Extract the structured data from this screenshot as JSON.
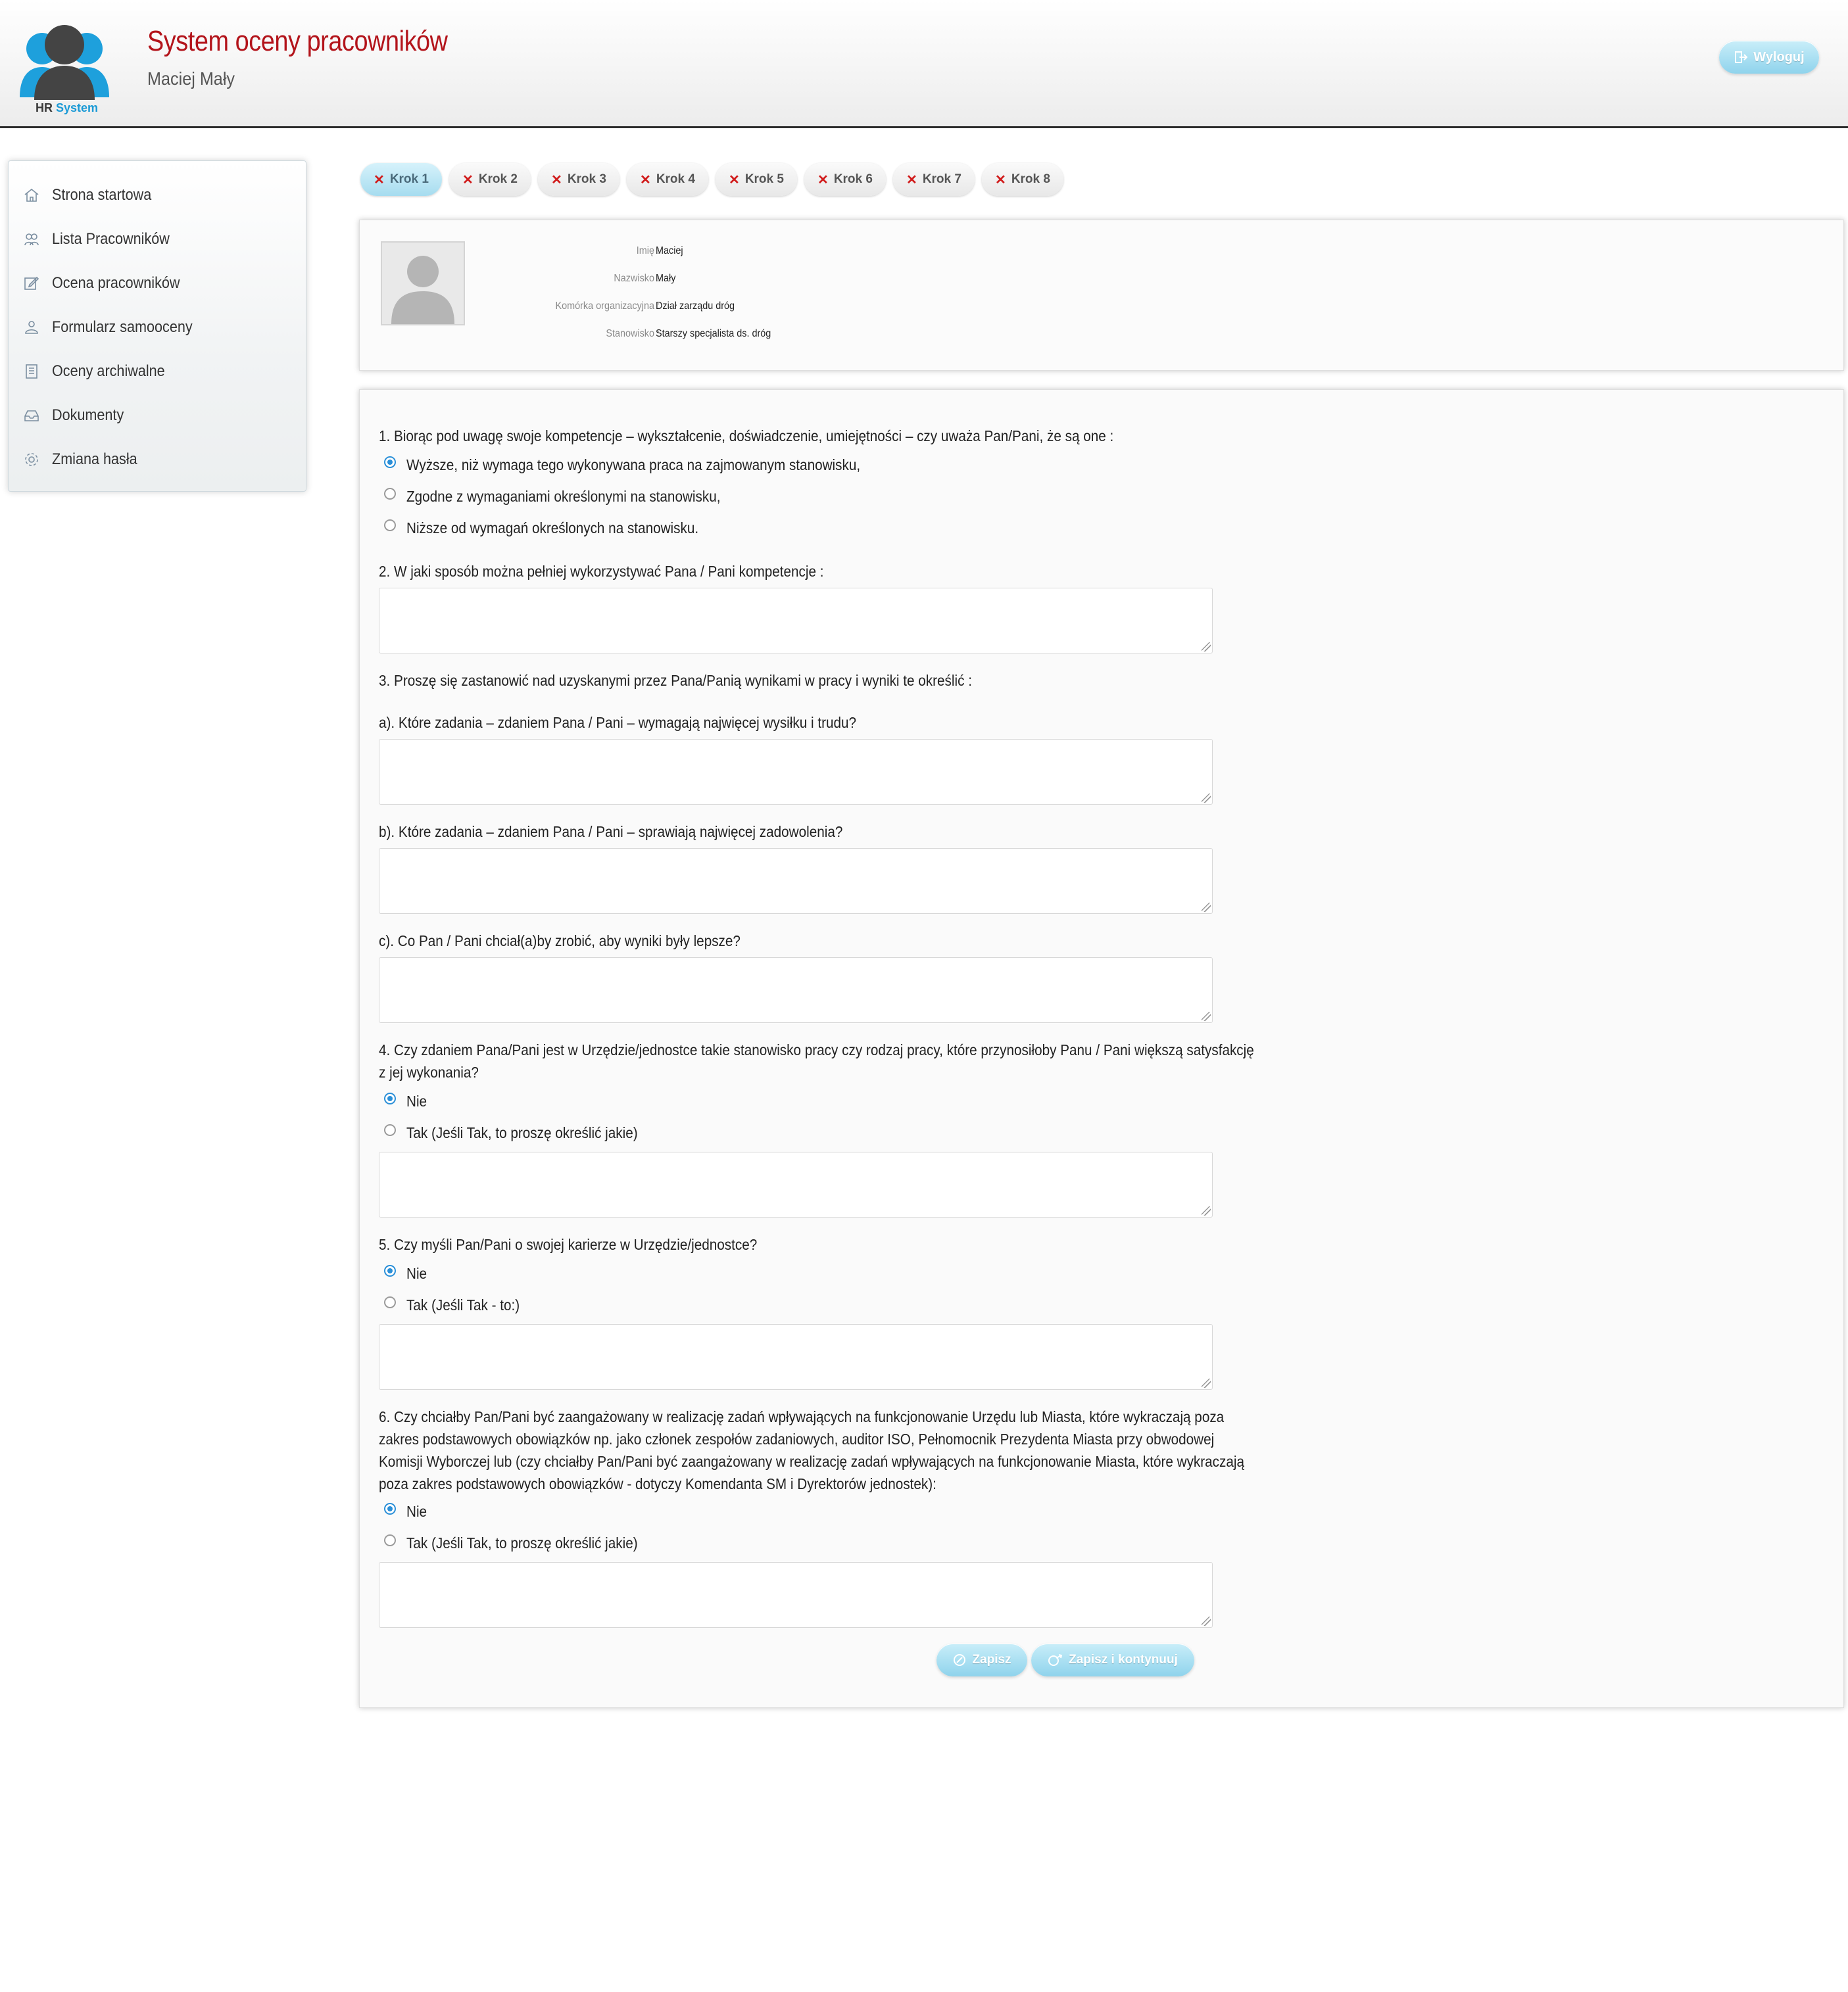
{
  "header": {
    "logo_text_main": "HR",
    "logo_text_accent": "System",
    "title": "System oceny pracowników",
    "user": "Maciej Mały",
    "logout_label": "Wyloguj"
  },
  "sidebar": {
    "items": [
      {
        "label": "Strona startowa",
        "icon": "home-icon"
      },
      {
        "label": "Lista Pracowników",
        "icon": "users-icon"
      },
      {
        "label": "Ocena pracowników",
        "icon": "edit-icon"
      },
      {
        "label": "Formularz samooceny",
        "icon": "person-icon"
      },
      {
        "label": "Oceny archiwalne",
        "icon": "archive-icon"
      },
      {
        "label": "Dokumenty",
        "icon": "inbox-icon"
      },
      {
        "label": "Zmiana hasła",
        "icon": "gear-icon"
      }
    ]
  },
  "tabs": [
    {
      "label": "Krok 1",
      "active": true
    },
    {
      "label": "Krok 2"
    },
    {
      "label": "Krok 3"
    },
    {
      "label": "Krok 4"
    },
    {
      "label": "Krok 5"
    },
    {
      "label": "Krok 6"
    },
    {
      "label": "Krok 7"
    },
    {
      "label": "Krok 8"
    }
  ],
  "employee": {
    "first_name_label": "Imię :",
    "first_name": "Maciej",
    "last_name_label": "Nazwisko :",
    "last_name": "Mały",
    "unit_label": "Komórka organizacyjna :",
    "unit": "Dział zarządu dróg",
    "position_label": "Stanowisko :",
    "position": "Starszy specjalista ds. dróg"
  },
  "form": {
    "q1": "1. Biorąc pod uwagę swoje kompetencje – wykształcenie, doświadczenie, umiejętności – czy uważa Pan/Pani, że są one :",
    "q1_options": [
      "Wyższe, niż wymaga tego wykonywana praca na zajmowanym stanowisku,",
      "Zgodne z wymaganiami określonymi na stanowisku,",
      "Niższe od wymagań określonych na stanowisku."
    ],
    "q1_selected": 0,
    "q2": "2. W jaki sposób można pełniej wykorzystywać Pana / Pani kompetencje :",
    "q3": "3. Proszę się zastanowić nad uzyskanymi przez Pana/Panią wynikami w pracy i wyniki te określić :",
    "q3a": "a). Które zadania – zdaniem Pana / Pani – wymagają najwięcej wysiłku i trudu?",
    "q3b": "b). Które zadania – zdaniem Pana / Pani – sprawiają najwięcej zadowolenia?",
    "q3c": "c). Co Pan / Pani chciał(a)by zrobić, aby wyniki były lepsze?",
    "q4_line1": "4. Czy zdaniem Pana/Pani jest w Urzędzie/jednostce takie stanowisko pracy czy rodzaj pracy, które przynosiłoby Panu / Pani większą satysfakcję",
    "q4_line2": "z jej wykonania?",
    "q4_options": [
      "Nie",
      "Tak (Jeśli Tak, to proszę określić jakie)"
    ],
    "q4_selected": 0,
    "q5": "5. Czy myśli Pan/Pani o swojej karierze w Urzędzie/jednostce?",
    "q5_options": [
      "Nie",
      "Tak (Jeśli Tak - to:)"
    ],
    "q5_selected": 0,
    "q6_line1": "6. Czy chciałby Pan/Pani być zaangażowany w realizację zadań wpływających na funkcjonowanie Urzędu lub Miasta, które wykraczają poza",
    "q6_line2": "zakres podstawowych obowiązków np. jako członek zespołów zadaniowych, auditor ISO, Pełnomocnik Prezydenta Miasta przy obwodowej",
    "q6_line3": "Komisji Wyborczej lub (czy chciałby Pan/Pani być zaangażowany w realizację zadań wpływających na funkcjonowanie Miasta, które wykraczają",
    "q6_line4": "poza zakres podstawowych obowiązków - dotyczy Komendanta SM i Dyrektorów jednostek):",
    "q6_options": [
      "Nie",
      "Tak (Jeśli Tak, to proszę określić jakie)"
    ],
    "q6_selected": 0,
    "save_label": "Zapisz",
    "save_continue_label": "Zapisz i kontynuuj"
  },
  "colors": {
    "title_red": "#b3141b",
    "accent_blue": "#1a9ad6",
    "button_blue": "#8fd3ec",
    "tab_error_x": "#d11b1b"
  }
}
